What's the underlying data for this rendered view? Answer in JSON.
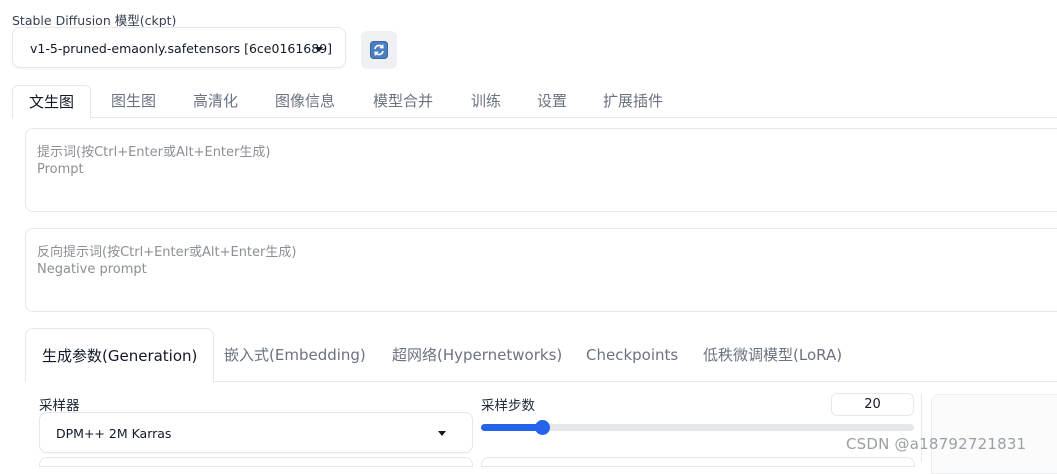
{
  "checkpoint": {
    "label": "Stable Diffusion 模型(ckpt)",
    "value": "v1-5-pruned-emaonly.safetensors [6ce0161689]",
    "refresh_icon": "refresh-icon"
  },
  "main_tabs": [
    {
      "label": "文生图",
      "active": true
    },
    {
      "label": "图生图"
    },
    {
      "label": "高清化"
    },
    {
      "label": "图像信息"
    },
    {
      "label": "模型合并"
    },
    {
      "label": "训练"
    },
    {
      "label": "设置"
    },
    {
      "label": "扩展插件"
    }
  ],
  "prompt": {
    "label": "提示词(按Ctrl+Enter或Alt+Enter生成)",
    "placeholder": "Prompt"
  },
  "negative_prompt": {
    "label": "反向提示词(按Ctrl+Enter或Alt+Enter生成)",
    "placeholder": "Negative prompt"
  },
  "gen_tabs": [
    {
      "label": "生成参数(Generation)",
      "active": true
    },
    {
      "label": "嵌入式(Embedding)"
    },
    {
      "label": "超网络(Hypernetworks)"
    },
    {
      "label": "Checkpoints"
    },
    {
      "label": "低秩微调模型(LoRA)"
    }
  ],
  "sampler": {
    "label": "采样器",
    "value": "DPM++ 2M Karras"
  },
  "steps": {
    "label": "采样步数",
    "value": "20",
    "slider_fraction": 0.14
  },
  "colors": {
    "accent": "#2563eb",
    "border": "#e5e7eb"
  },
  "watermark": "CSDN @a18792721831"
}
